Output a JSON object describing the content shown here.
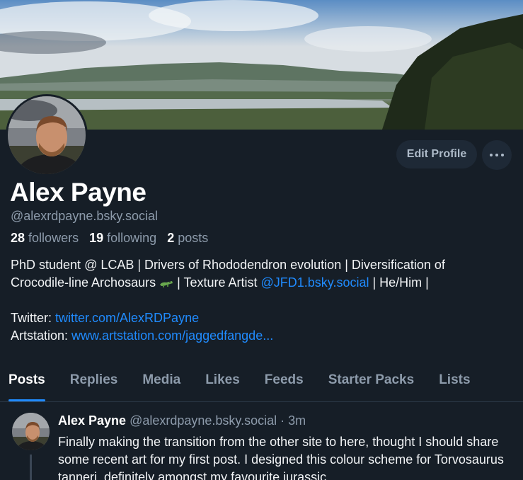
{
  "profile": {
    "display_name": "Alex Payne",
    "handle": "@alexrdpayne.bsky.social",
    "stats": {
      "followers_count": "28",
      "followers_label": "followers",
      "following_count": "19",
      "following_label": "following",
      "posts_count": "2",
      "posts_label": "posts"
    },
    "bio": {
      "line1": "PhD student @ LCAB | Drivers of Rhododendron evolution | Diversification of",
      "line2_pre": "Crocodile-line Archosaurs",
      "line2_mid": " | Texture Artist ",
      "line2_mention": "@JFD1.bsky.social",
      "line2_post": " | He/Him |",
      "twitter_label": "Twitter: ",
      "twitter_link": "twitter.com/AlexRDPayne",
      "artstation_label": "Artstation: ",
      "artstation_link": "www.artstation.com/jaggedfangde..."
    }
  },
  "actions": {
    "edit_label": "Edit Profile"
  },
  "tabs": [
    {
      "label": "Posts",
      "active": true
    },
    {
      "label": "Replies",
      "active": false
    },
    {
      "label": "Media",
      "active": false
    },
    {
      "label": "Likes",
      "active": false
    },
    {
      "label": "Feeds",
      "active": false
    },
    {
      "label": "Starter Packs",
      "active": false
    },
    {
      "label": "Lists",
      "active": false
    }
  ],
  "post": {
    "author_name": "Alex Payne",
    "author_handle": "@alexrdpayne.bsky.social",
    "time": " · 3m",
    "text": "Finally making the transition from the other site to here, thought I should share some recent art for my first post. I designed this colour scheme for Torvosaurus tanneri, definitely amongst my favourite jurassic"
  },
  "colors": {
    "background": "#161e27",
    "accent": "#208bfe",
    "muted_text": "#8d9bab",
    "button_bg": "#1e2936"
  },
  "icons": {
    "more": "ellipsis-horizontal-icon",
    "croc": "crocodile-emoji-icon"
  }
}
